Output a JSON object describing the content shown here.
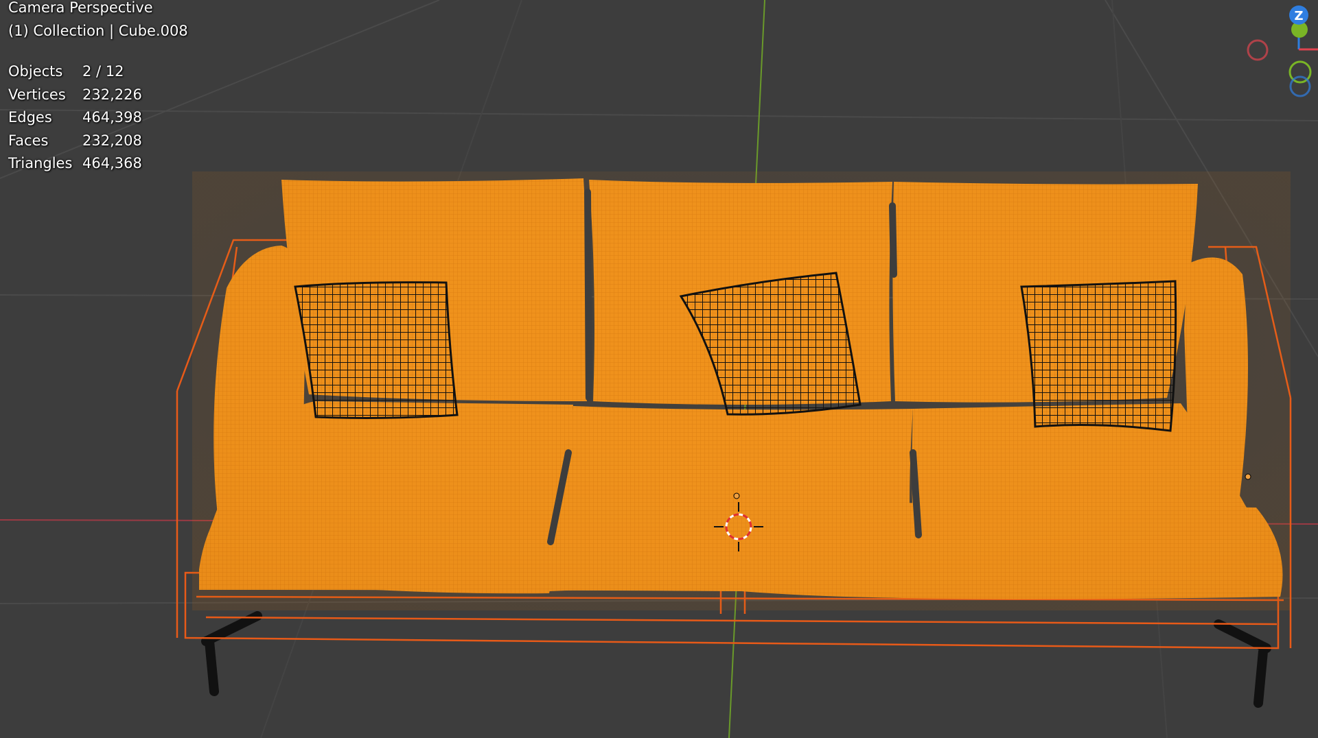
{
  "viewport": {
    "title": "Camera Perspective",
    "collection_label": "(1) Collection | Cube.008",
    "stats": [
      {
        "label": "Objects",
        "value": "2 / 12"
      },
      {
        "label": "Vertices",
        "value": "232,226"
      },
      {
        "label": "Edges",
        "value": "464,398"
      },
      {
        "label": "Faces",
        "value": "232,208"
      },
      {
        "label": "Triangles",
        "value": "464,368"
      }
    ]
  },
  "gizmo": {
    "z_label": "Z",
    "axis_colors": {
      "x": "#e0444f",
      "y": "#7ab526",
      "z": "#2f7ee0"
    }
  },
  "scene": {
    "selection_color": "#f0921b",
    "bbox_color": "#e85a18",
    "background": "#3d3d3d"
  }
}
